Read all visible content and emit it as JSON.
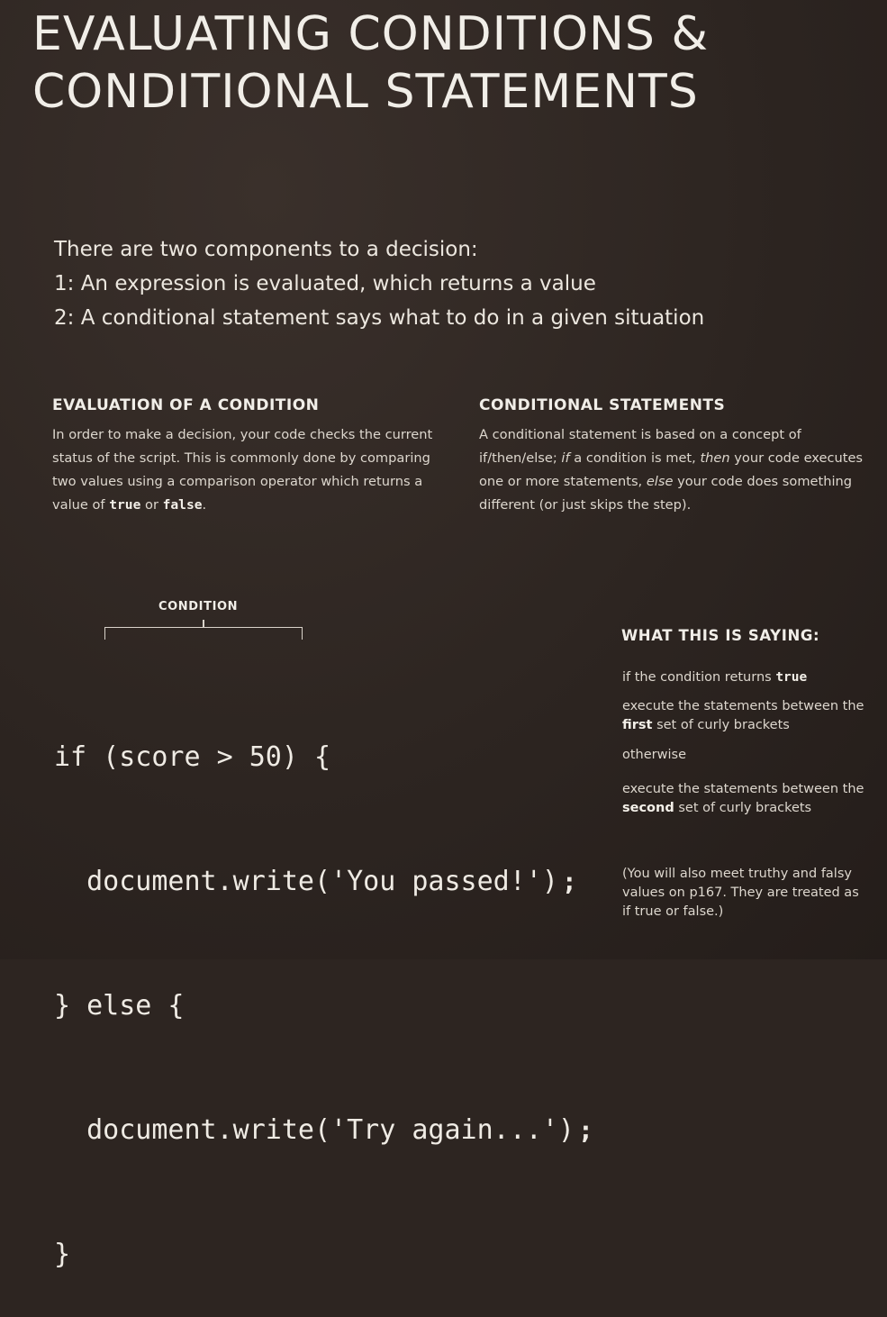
{
  "title": {
    "line1": "EVALUATING CONDITIONS &",
    "line2": "CONDITIONAL STATEMENTS"
  },
  "intro": {
    "line1": "There are two components to a decision:",
    "line2": "1: An expression is evaluated, which returns a value",
    "line3": "2: A conditional statement says what to do in a given situation"
  },
  "evaluation": {
    "heading": "EVALUATION OF A CONDITION",
    "text_before": "In order to make a decision, your code checks the current status of the script. This is commonly done by comparing two values using a comparison operator which returns a value of ",
    "true_word": "true",
    "or_word": " or ",
    "false_word": "false",
    "end": "."
  },
  "conditional": {
    "heading": "CONDITIONAL STATEMENTS",
    "t1": "A conditional statement is based on a concept of if/then/else; ",
    "if_word": "if",
    "t2": " a condition is met, ",
    "then_word": "then",
    "t3": " your code executes one or more statements, ",
    "else_word": "else",
    "t4": " your code does something different (or just skips the step)."
  },
  "code": {
    "condition_label": "CONDITION",
    "line1": "if (score > 50) {",
    "line2": "  document.write('You passed!')",
    "line3": "} else {",
    "line4": "  document.write('Try again...')",
    "line5": "}",
    "semicolon": ";"
  },
  "explanation": {
    "heading": "WHAT THIS IS SAYING:",
    "e1_text": "if the condition returns ",
    "e1_bold": "true",
    "e2_text": "execute the statements between the ",
    "e2_bold": "first",
    "e2_end": " set of curly brackets",
    "e3_text": "otherwise",
    "e4_text": "execute the statements between the ",
    "e4_bold": "second",
    "e4_end": " set of curly brackets"
  },
  "note": "(You will also meet truthy and falsy values on p167. They are treated as if true or false.)"
}
